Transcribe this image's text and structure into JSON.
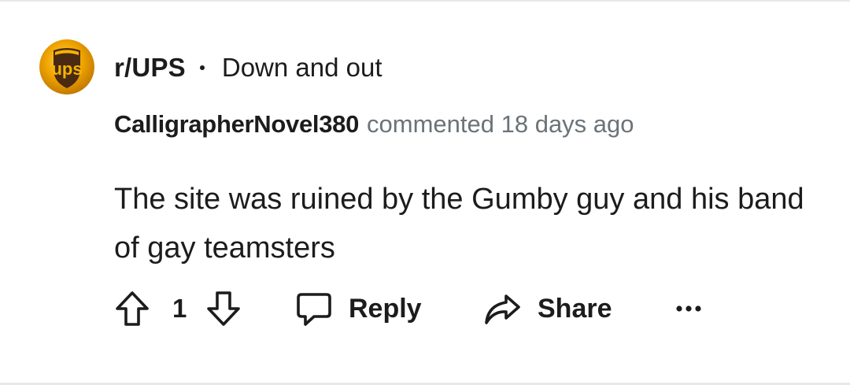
{
  "post": {
    "subreddit": "r/UPS",
    "separator": "•",
    "title": "Down and out",
    "avatar_icon": "ups-logo-icon",
    "avatar_text": "ups"
  },
  "comment": {
    "author": "CalligrapherNovel380",
    "meta": "commented 18 days ago",
    "body": "The site was ruined by the Gumby guy and his band of gay teamsters"
  },
  "actions": {
    "upvote_icon": "arrow-up-icon",
    "vote_count": "1",
    "downvote_icon": "arrow-down-icon",
    "reply_icon": "speech-bubble-icon",
    "reply_label": "Reply",
    "share_icon": "share-arrow-icon",
    "share_label": "Share",
    "more_icon": "ellipsis-icon"
  },
  "colors": {
    "text": "#1c1c1c",
    "meta": "#6b7377",
    "ups_brown": "#4a2a12",
    "ups_gold": "#f5b400"
  }
}
